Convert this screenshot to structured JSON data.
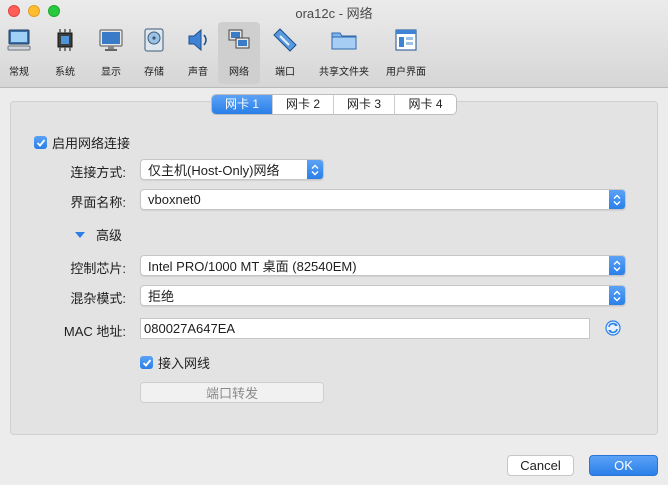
{
  "window": {
    "title": "ora12c - 网络"
  },
  "toolbar": {
    "items": [
      {
        "label": "常规",
        "icon": "monitor-icon"
      },
      {
        "label": "系统",
        "icon": "chip-icon"
      },
      {
        "label": "显示",
        "icon": "display-icon"
      },
      {
        "label": "存储",
        "icon": "disk-icon"
      },
      {
        "label": "声音",
        "icon": "speaker-icon"
      },
      {
        "label": "网络",
        "icon": "network-icon"
      },
      {
        "label": "端口",
        "icon": "port-icon"
      },
      {
        "label": "共享文件夹",
        "icon": "folder-icon"
      },
      {
        "label": "用户界面",
        "icon": "ui-window-icon"
      }
    ],
    "active_index": 5
  },
  "tabs": [
    "网卡 1",
    "网卡 2",
    "网卡 3",
    "网卡 4"
  ],
  "active_tab": 0,
  "form": {
    "enable_label": "启用网络连接",
    "enable_checked": true,
    "attach_label": "连接方式:",
    "attach_value": "仅主机(Host-Only)网络",
    "name_label": "界面名称:",
    "name_value": "vboxnet0",
    "advanced_label": "高级",
    "adapter_label": "控制芯片:",
    "adapter_value": "Intel PRO/1000 MT 桌面 (82540EM)",
    "promisc_label": "混杂模式:",
    "promisc_value": "拒绝",
    "mac_label": "MAC 地址:",
    "mac_value": "080027A647EA",
    "cable_label": "接入网线",
    "cable_checked": true,
    "port_forward_label": "端口转发"
  },
  "buttons": {
    "cancel": "Cancel",
    "ok": "OK"
  },
  "colors": {
    "accent": "#2a7fe8",
    "panel": "#e3e3e3"
  }
}
